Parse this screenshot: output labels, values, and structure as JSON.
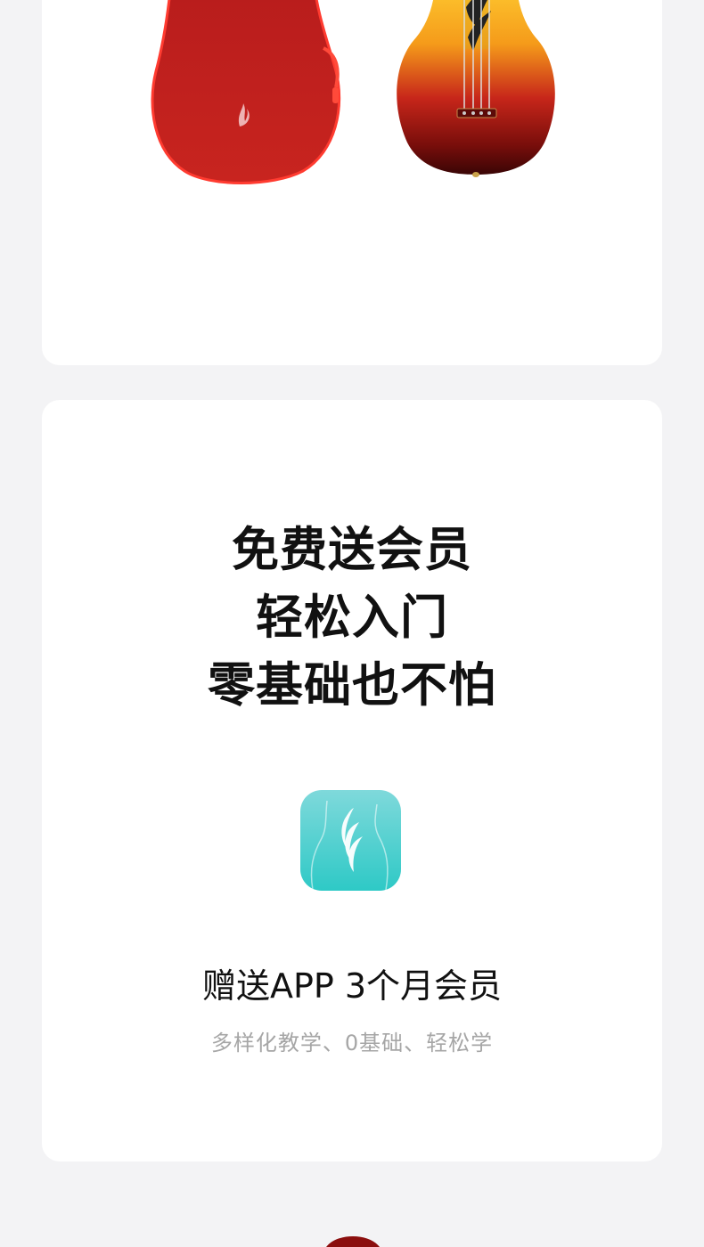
{
  "products": {
    "bag_label": "ukulele-gig-bag",
    "ukulele_label": "ukulele"
  },
  "promo": {
    "headline_lines": [
      "免费送会员",
      "轻松入门",
      "零基础也不怕"
    ],
    "app_icon": "ukulele-app-icon",
    "gift_title": "赠送APP  3个月会员",
    "gift_subtitle": "多样化教学、0基础、轻松学"
  },
  "colors": {
    "page_bg": "#f3f3f5",
    "card_bg": "#ffffff",
    "bag_red": "#c0201f",
    "app_teal": "#2ec9c6",
    "subtitle_gray": "#a6a6a6",
    "accent_dark_red": "#8b0e0e"
  }
}
